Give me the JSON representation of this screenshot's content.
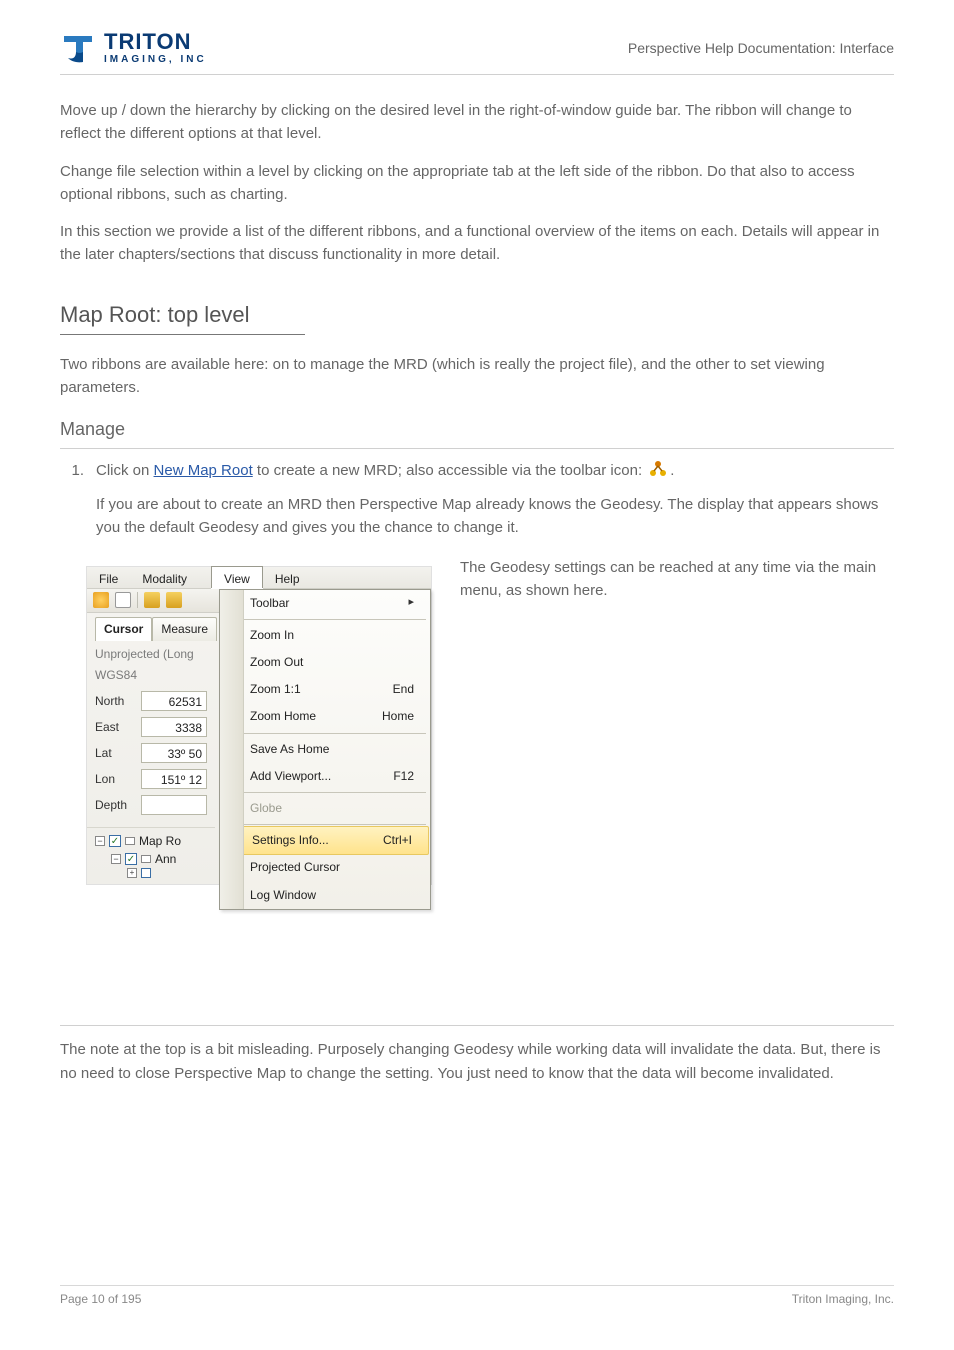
{
  "header": {
    "brand_top": "TRITON",
    "brand_sub": "IMAGING, INC",
    "doc_title": "Perspective Help Documentation: Interface"
  },
  "intro": {
    "p1": "Move up / down the hierarchy by clicking on the desired level in the right-of-window guide bar. The ribbon will change to reflect the different options at that level.",
    "p2": "Change file selection within a level by clicking on the appropriate tab at the left side of the ribbon. Do that also to access optional ribbons, such as charting.",
    "p3": "In this section we provide a list of the different ribbons, and a functional overview of the items on each. Details will appear in the later chapters/sections that discuss functionality in more detail."
  },
  "sections": {
    "map_root_title": "Map Root: top level",
    "map_root_body": "Two ribbons are available here: on to manage the MRD (which is really the project file), and the other to set viewing parameters.",
    "manage_title": "Manage",
    "manage_bullet1_prefix": "Click on ",
    "manage_bullet1_link": "New Map Root",
    "manage_bullet1_suffix": " to create a new MRD; also accessible via the toolbar icon:",
    "manage_info": "If you are about to create an MRD then Perspective Map already knows the Geodesy. The display that appears shows you the default Geodesy and gives you the chance to change it.",
    "manage_note": "The note at the top is a bit misleading. Purposely changing Geodesy while working data will invalidate the data. But, there is no need to close Perspective Map to change the setting. You just need to know that the data will become invalidated.",
    "geodesy_title": "The Geodesy settings can be reached at any time via the main menu, as shown here."
  },
  "screenshot": {
    "menus": {
      "file": "File",
      "modality": "Modality",
      "view": "View",
      "help": "Help"
    },
    "tabs": {
      "cursor": "Cursor",
      "measure": "Measure"
    },
    "proj1": "Unprojected (Long",
    "proj2": "WGS84",
    "fields": {
      "north_label": "North",
      "north_val": "62531",
      "east_label": "East",
      "east_val": "3338",
      "lat_label": "Lat",
      "lat_val": "33º 50",
      "lon_label": "Lon",
      "lon_val": "151º 12",
      "depth_label": "Depth",
      "depth_val": ""
    },
    "tree": {
      "maproot": "Map Ro",
      "ann": "Ann"
    },
    "dropdown": {
      "toolbar": "Toolbar",
      "zoom_in": "Zoom In",
      "zoom_out": "Zoom Out",
      "zoom_11": "Zoom 1:1",
      "zoom_11_sc": "End",
      "zoom_home": "Zoom Home",
      "zoom_home_sc": "Home",
      "save_home": "Save As Home",
      "add_vp": "Add Viewport...",
      "add_vp_sc": "F12",
      "globe": "Globe",
      "settings": "Settings Info...",
      "settings_sc": "Ctrl+I",
      "proj_cursor": "Projected Cursor",
      "log_win": "Log Window"
    }
  },
  "footer": {
    "left": "Page 10 of 195",
    "right": "Triton Imaging, Inc."
  }
}
